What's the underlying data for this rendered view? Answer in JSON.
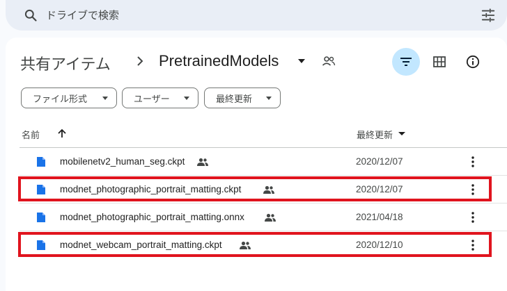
{
  "search": {
    "placeholder": "ドライブで検索"
  },
  "breadcrumb": {
    "root": "共有アイテム",
    "current": "PretrainedModels"
  },
  "filters": [
    {
      "label": "ファイル形式"
    },
    {
      "label": "ユーザー"
    },
    {
      "label": "最終更新"
    }
  ],
  "table": {
    "col_name": "名前",
    "col_modified": "最終更新",
    "rows": [
      {
        "name": "mobilenetv2_human_seg.ckpt",
        "date": "2020/12/07",
        "shared": true,
        "highlighted": false
      },
      {
        "name": "modnet_photographic_portrait_matting.ckpt",
        "date": "2020/12/07",
        "shared": true,
        "highlighted": true
      },
      {
        "name": "modnet_photographic_portrait_matting.onnx",
        "date": "2021/04/18",
        "shared": true,
        "highlighted": false
      },
      {
        "name": "modnet_webcam_portrait_matting.ckpt",
        "date": "2020/12/10",
        "shared": true,
        "highlighted": true
      }
    ]
  },
  "colors": {
    "accent": "#c2e7ff",
    "file_icon": "#1a73e8",
    "highlight": "#e0141e"
  }
}
